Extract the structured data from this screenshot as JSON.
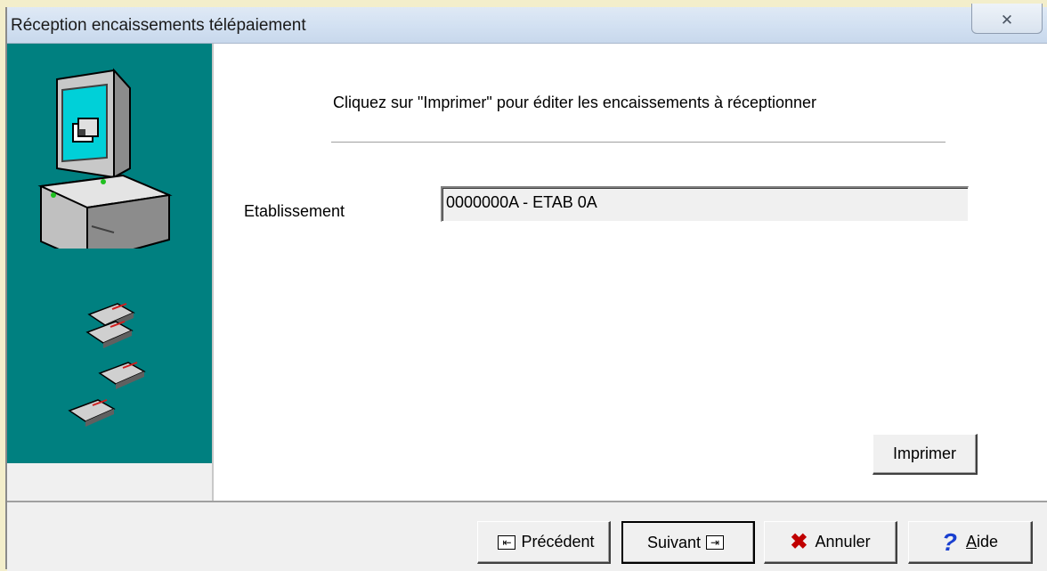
{
  "window": {
    "title": "Réception encaissements télépaiement",
    "close_glyph": "✕"
  },
  "main": {
    "instruction": "Cliquez sur \"Imprimer\" pour éditer les encaissements à réceptionner",
    "field_label": "Etablissement",
    "field_value": "0000000A - ETAB 0A",
    "print_label": "Imprimer"
  },
  "footer": {
    "prev_label": "Précédent",
    "next_label": "Suivant",
    "cancel_label": "Annuler",
    "help_label": "Aide"
  },
  "colors": {
    "teal_panel": "#008080",
    "title_bar": "#d3e1f2",
    "cancel_icon": "#c00000",
    "help_icon": "#1a40d0"
  },
  "icons": [
    "computer-icon",
    "floppy-disk-icon",
    "close-icon",
    "prev-arrow-icon",
    "next-arrow-icon",
    "cancel-x-icon",
    "help-question-icon"
  ]
}
